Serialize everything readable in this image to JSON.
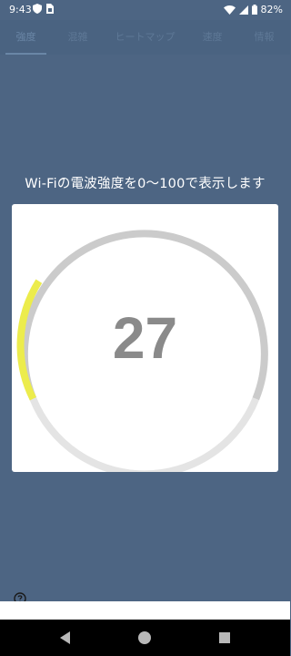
{
  "status_bar": {
    "time": "9:43",
    "battery": "82%"
  },
  "tabs": [
    {
      "label": "強度",
      "active": true
    },
    {
      "label": "混雑",
      "active": false
    },
    {
      "label": "ヒートマップ",
      "active": false
    },
    {
      "label": "速度",
      "active": false
    },
    {
      "label": "情報",
      "active": false
    }
  ],
  "caption": "Wi-Fiの電波強度を0〜100で表示します",
  "gauge": {
    "value": "27",
    "level": 0.27,
    "colors": {
      "active": "#ecec4c",
      "track_upper": "#cbcbcb",
      "track_lower": "#e4e4e4"
    }
  },
  "icons": {
    "help": "help-circle-icon",
    "back": "back-triangle-icon",
    "home": "home-circle-icon",
    "recents": "recents-square-icon"
  },
  "colors": {
    "background": "#4d6583",
    "tab_bar": "#4a6381",
    "card": "#ffffff"
  }
}
